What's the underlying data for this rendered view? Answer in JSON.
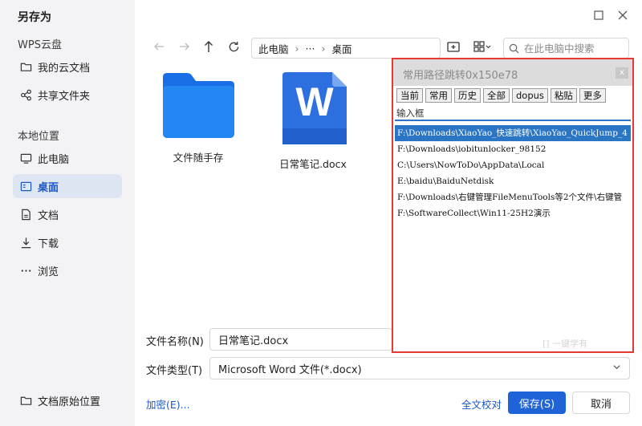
{
  "dialog": {
    "title": "另存为",
    "sidebar": {
      "cloud_section": "WPS云盘",
      "cloud_items": [
        {
          "label": "我的云文档",
          "icon": "folder-icon"
        },
        {
          "label": "共享文件夹",
          "icon": "share-icon"
        }
      ],
      "local_section": "本地位置",
      "local_items": [
        {
          "label": "此电脑",
          "icon": "monitor-icon"
        },
        {
          "label": "桌面",
          "icon": "desktop-icon",
          "active": true
        },
        {
          "label": "文档",
          "icon": "document-icon"
        },
        {
          "label": "下载",
          "icon": "download-icon"
        },
        {
          "label": "浏览",
          "icon": "more-icon"
        }
      ],
      "bottom_item": "文档原始位置"
    },
    "address": {
      "root": "此电脑",
      "ellipsis": "···",
      "current": "桌面"
    },
    "search_placeholder": "在此电脑中搜索",
    "files": [
      {
        "name": "文件随手存",
        "type": "folder"
      },
      {
        "name": "日常笔记.docx",
        "type": "word"
      }
    ],
    "word_icon_letter": "W",
    "filename_label": "文件名称(N)",
    "filename_value": "日常笔记.docx",
    "filetype_label": "文件类型(T)",
    "filetype_value": "Microsoft Word 文件(*.docx)",
    "encrypt_link": "加密(E)...",
    "proofread_link": "全文校对",
    "save_button": "保存(S)",
    "cancel_button": "取消"
  },
  "quickjump": {
    "title": "常用路径跳转0x150e78",
    "close": "x",
    "buttons": [
      "当前",
      "常用",
      "历史",
      "全部",
      "dopus",
      "粘贴",
      "更多"
    ],
    "input_placeholder": "输入框",
    "paths": [
      "F:\\Downloads\\XiaoYao_快速跳转\\XiaoYao_QuickJump_4",
      "F:\\Downloads\\iobitunlocker_98152",
      "C:\\Users\\NowToDo\\AppData\\Local",
      "E:\\baidu\\BaiduNetdisk",
      "F:\\Downloads\\右键管理FileMenuTools等2个文件\\右键管",
      "F:\\SoftwareCollect\\Win11-25H2演示"
    ],
    "selected_index": 0,
    "faded_text": "[] 一键学有"
  },
  "colors": {
    "accent": "#1f63d8",
    "highlight": "#2b76c4",
    "annotation": "#e53935",
    "folder": "#1e7ef0"
  }
}
